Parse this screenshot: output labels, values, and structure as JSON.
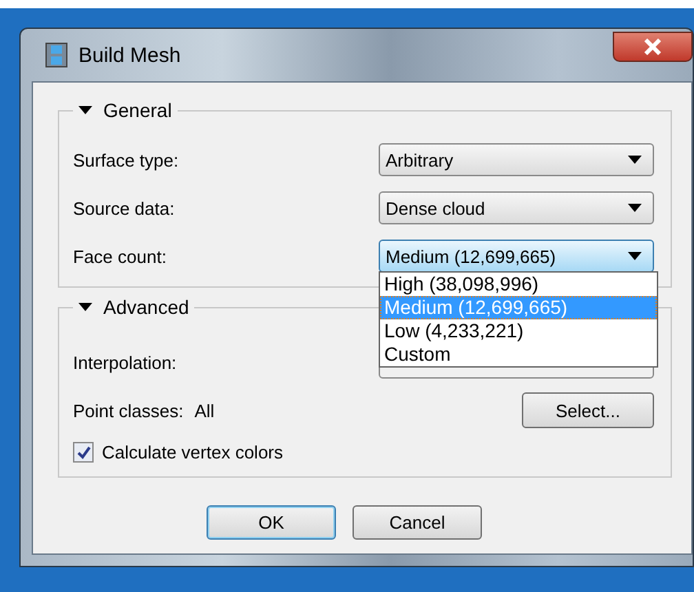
{
  "window": {
    "title": "Build Mesh"
  },
  "general": {
    "title": "General",
    "expanded": true,
    "fields": [
      {
        "label": "Surface type:",
        "value": "Arbitrary",
        "open": false
      },
      {
        "label": "Source data:",
        "value": "Dense cloud",
        "open": false
      },
      {
        "label": "Face count:",
        "value": "Medium (12,699,665)",
        "open": true,
        "options": [
          {
            "label": "High (38,098,996)",
            "selected": false
          },
          {
            "label": "Medium (12,699,665)",
            "selected": true
          },
          {
            "label": "Low (4,233,221)",
            "selected": false
          },
          {
            "label": "Custom",
            "selected": false
          }
        ]
      }
    ]
  },
  "advanced": {
    "title": "Advanced",
    "expanded": true,
    "interpolation_label": "Interpolation:",
    "point_classes_label": "Point classes:",
    "point_classes_value": "All",
    "select_button": "Select...",
    "checkbox": {
      "label": "Calculate vertex colors",
      "checked": true
    }
  },
  "buttons": [
    {
      "label": "OK",
      "default": true
    },
    {
      "label": "Cancel",
      "default": false
    }
  ]
}
